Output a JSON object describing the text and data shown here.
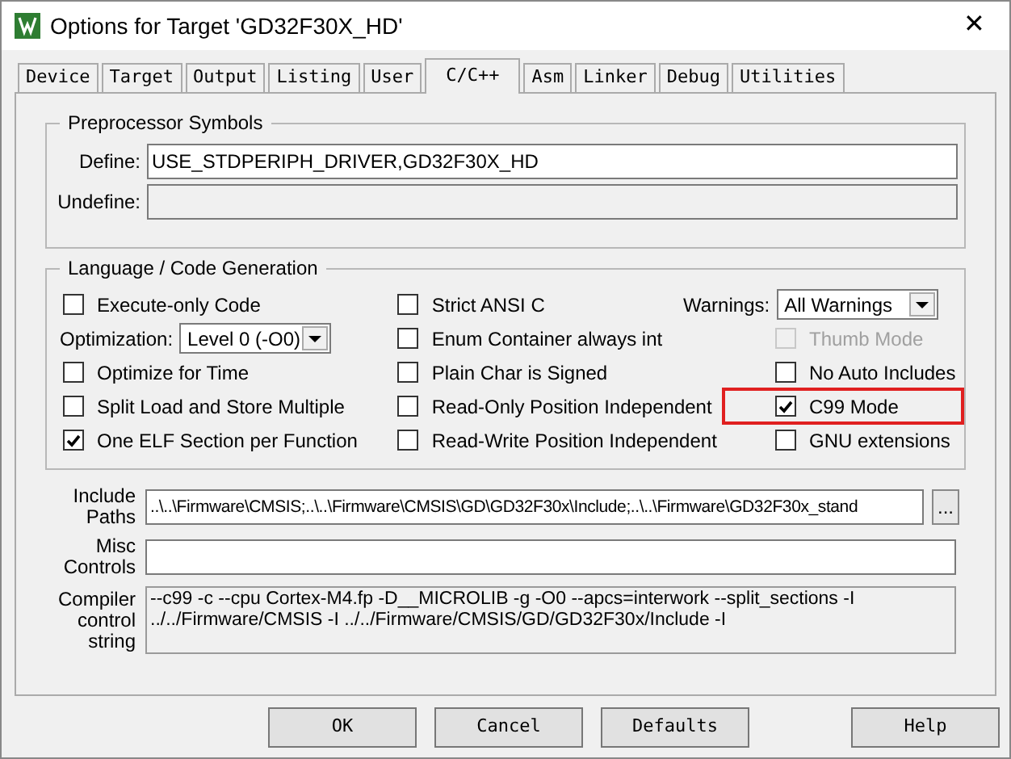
{
  "window": {
    "title": "Options for Target 'GD32F30X_HD'",
    "close": "✕"
  },
  "tabs": [
    {
      "label": "Device",
      "selected": false
    },
    {
      "label": "Target",
      "selected": false
    },
    {
      "label": "Output",
      "selected": false
    },
    {
      "label": "Listing",
      "selected": false
    },
    {
      "label": "User",
      "selected": false
    },
    {
      "label": "C/C++",
      "selected": true
    },
    {
      "label": "Asm",
      "selected": false
    },
    {
      "label": "Linker",
      "selected": false
    },
    {
      "label": "Debug",
      "selected": false
    },
    {
      "label": "Utilities",
      "selected": false
    }
  ],
  "preprocessor": {
    "title": "Preprocessor Symbols",
    "fields": [
      {
        "label": "Define:",
        "value": "USE_STDPERIPH_DRIVER,GD32F30X_HD",
        "disabled": false
      },
      {
        "label": "Undefine:",
        "disabled": true
      }
    ]
  },
  "language": {
    "title": "Language / Code Generation",
    "columns": [
      [
        {
          "kind": "checkbox",
          "label": "Execute-only Code",
          "checked": false,
          "disabled": false,
          "highlighted": false
        },
        {
          "kind": "select",
          "label": "Optimization:",
          "value": "Level 0 (-O0)"
        },
        {
          "kind": "checkbox",
          "label": "Optimize for Time",
          "checked": false,
          "disabled": false,
          "highlighted": false
        },
        {
          "kind": "checkbox",
          "label": "Split Load and Store Multiple",
          "checked": false,
          "disabled": false,
          "highlighted": false
        },
        {
          "kind": "checkbox",
          "label": "One ELF Section per Function",
          "checked": true,
          "disabled": false,
          "highlighted": false
        }
      ],
      [
        {
          "kind": "checkbox",
          "label": "Strict ANSI C",
          "checked": false,
          "disabled": false,
          "highlighted": false
        },
        {
          "kind": "checkbox",
          "label": "Enum Container always int",
          "checked": false,
          "disabled": false,
          "highlighted": false
        },
        {
          "kind": "checkbox",
          "label": "Plain Char is Signed",
          "checked": false,
          "disabled": false,
          "highlighted": false
        },
        {
          "kind": "checkbox",
          "label": "Read-Only Position Independent",
          "checked": false,
          "disabled": false,
          "highlighted": false
        },
        {
          "kind": "checkbox",
          "label": "Read-Write Position Independent",
          "checked": false,
          "disabled": false,
          "highlighted": false
        }
      ],
      [
        {
          "kind": "select",
          "label": "Warnings:",
          "value": "All Warnings"
        },
        {
          "kind": "checkbox",
          "label": "Thumb Mode",
          "checked": false,
          "disabled": true,
          "highlighted": false
        },
        {
          "kind": "checkbox",
          "label": "No Auto Includes",
          "checked": false,
          "disabled": false,
          "highlighted": false
        },
        {
          "kind": "checkbox",
          "label": "C99 Mode",
          "checked": true,
          "disabled": false,
          "highlighted": true
        },
        {
          "kind": "checkbox",
          "label": "GNU extensions",
          "checked": false,
          "disabled": false,
          "highlighted": false
        }
      ]
    ]
  },
  "include_paths": {
    "label_lines": [
      "Include",
      "Paths"
    ],
    "value": "..\\..\\Firmware\\CMSIS;..\\..\\Firmware\\CMSIS\\GD\\GD32F30x\\Include;..\\..\\Firmware\\GD32F30x_stand",
    "browse": "..."
  },
  "misc_controls": {
    "label_lines": [
      "Misc",
      "Controls"
    ]
  },
  "compiler_control_string": {
    "label_lines": [
      "Compiler",
      "control",
      "string"
    ],
    "lines": [
      "--c99 -c --cpu Cortex-M4.fp -D__MICROLIB -g -O0 --apcs=interwork --split_sections -I",
      "../../Firmware/CMSIS -I ../../Firmware/CMSIS/GD/GD32F30x/Include -I"
    ]
  },
  "buttons": [
    "OK",
    "Cancel",
    "Defaults"
  ],
  "help_button": "Help"
}
